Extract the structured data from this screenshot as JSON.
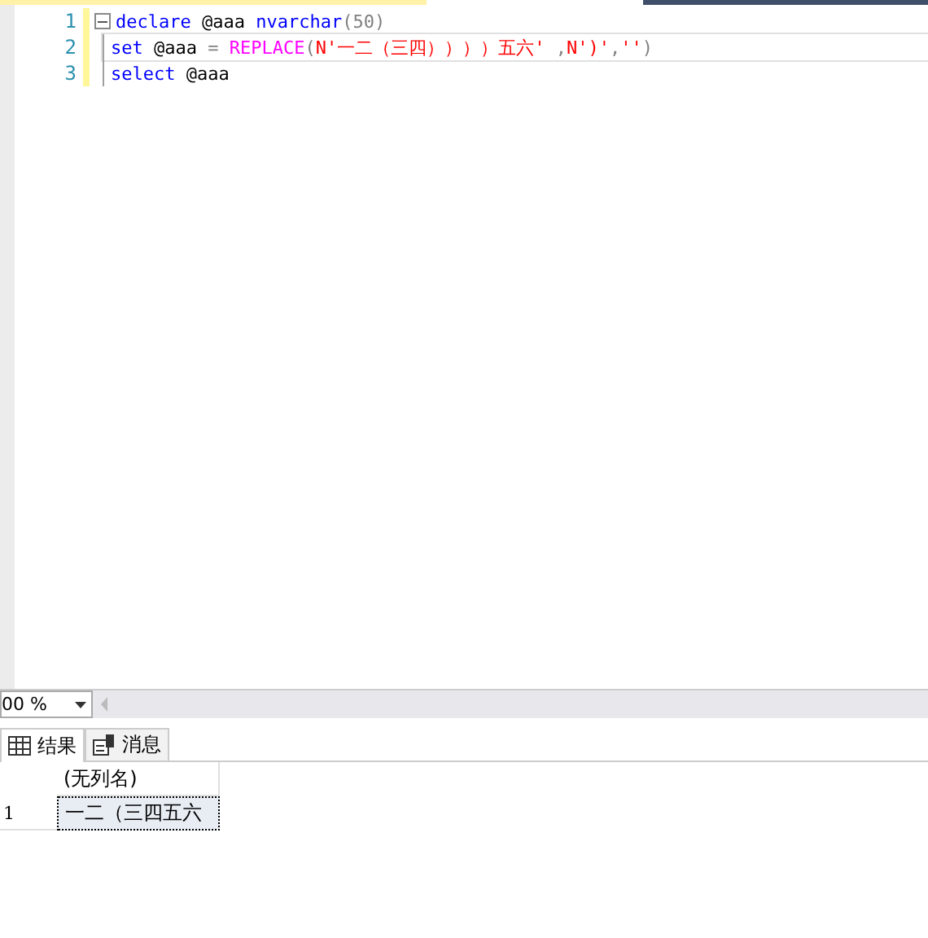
{
  "editor": {
    "lines": [
      {
        "number": "1",
        "collapse": true,
        "tokens": [
          {
            "kind": "keyword",
            "text": "declare"
          },
          {
            "kind": "plain",
            "text": " @aaa "
          },
          {
            "kind": "keyword",
            "text": "nvarchar"
          },
          {
            "kind": "operator",
            "text": "(50)"
          }
        ]
      },
      {
        "number": "2",
        "collapse": false,
        "tokens": [
          {
            "kind": "keyword",
            "text": "set"
          },
          {
            "kind": "plain",
            "text": " @aaa "
          },
          {
            "kind": "operator",
            "text": "= "
          },
          {
            "kind": "function",
            "text": "REPLACE"
          },
          {
            "kind": "operator",
            "text": "("
          },
          {
            "kind": "string",
            "text": "N'一二（三四））））五六'"
          },
          {
            "kind": "operator",
            "text": " ,"
          },
          {
            "kind": "string",
            "text": "N')'"
          },
          {
            "kind": "operator",
            "text": ","
          },
          {
            "kind": "string",
            "text": "''"
          },
          {
            "kind": "operator",
            "text": ")"
          }
        ]
      },
      {
        "number": "3",
        "collapse": false,
        "tokens": [
          {
            "kind": "keyword",
            "text": "select"
          },
          {
            "kind": "plain",
            "text": " @aaa"
          }
        ]
      }
    ]
  },
  "zoom": {
    "value": "00 %"
  },
  "tabs": [
    {
      "label": "结果",
      "kind": "grid",
      "selected": true
    },
    {
      "label": "消息",
      "kind": "message",
      "selected": false
    }
  ],
  "results": {
    "columns": [
      "(无列名)"
    ],
    "rows": [
      {
        "number": "1",
        "cells": [
          "一二（三四五六"
        ]
      }
    ]
  }
}
